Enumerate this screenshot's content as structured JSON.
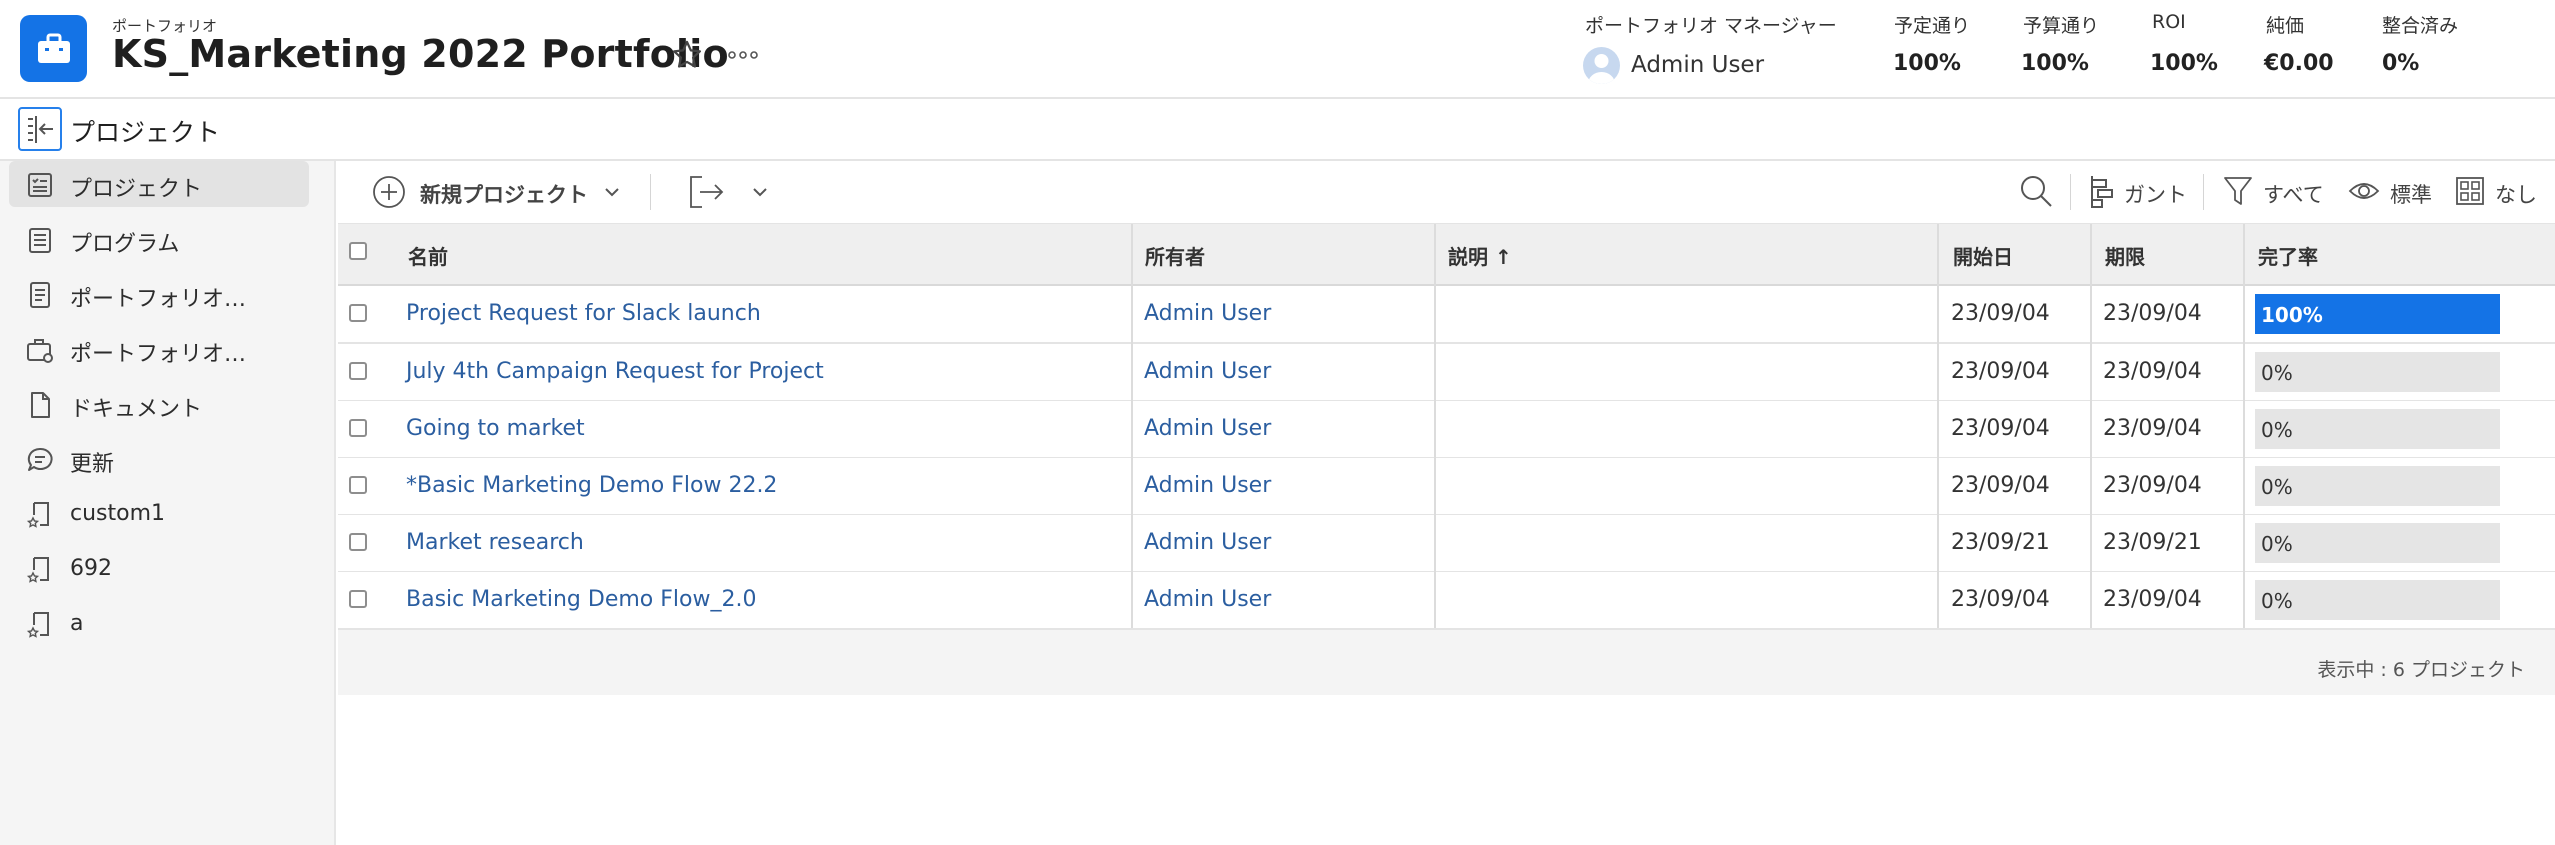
{
  "header": {
    "eyebrow": "ポートフォリオ",
    "title": "KS_Marketing 2022 Portfolio",
    "manager_label": "ポートフォリオ マネージャー",
    "manager_name": "Admin User",
    "metrics": [
      {
        "label": "予定通り",
        "value": "100%"
      },
      {
        "label": "予算通り",
        "value": "100%"
      },
      {
        "label": "ROI",
        "value": "100%"
      },
      {
        "label": "純価",
        "value": "€0.00"
      },
      {
        "label": "整合済み",
        "value": "0%"
      }
    ]
  },
  "subheader": {
    "title": "プロジェクト"
  },
  "sidebar": {
    "items": [
      {
        "label": "プロジェクト",
        "icon": "project-list-icon",
        "active": true
      },
      {
        "label": "プログラム",
        "icon": "program-list-icon"
      },
      {
        "label": "ポートフォリオ…",
        "icon": "portfolio-doc-icon"
      },
      {
        "label": "ポートフォリオ…",
        "icon": "portfolio-briefcase-icon"
      },
      {
        "label": "ドキュメント",
        "icon": "document-icon"
      },
      {
        "label": "更新",
        "icon": "comment-icon"
      },
      {
        "label": "custom1",
        "icon": "custom-tab-icon"
      },
      {
        "label": "692",
        "icon": "custom-tab-icon"
      },
      {
        "label": "a",
        "icon": "custom-tab-icon"
      }
    ]
  },
  "toolbar": {
    "new_project": "新規プロジェクト",
    "gantt": "ガント",
    "filter": "すべて",
    "view": "標準",
    "grouping": "なし"
  },
  "table": {
    "columns": {
      "name": "名前",
      "owner": "所有者",
      "description": "説明 ↑",
      "start": "開始日",
      "due": "期限",
      "complete": "完了率"
    },
    "rows": [
      {
        "name": "Project Request for Slack launch",
        "owner": "Admin User",
        "description": "",
        "start": "23/09/04",
        "due": "23/09/04",
        "complete_label": "100%",
        "complete": 100
      },
      {
        "name": "July 4th Campaign Request for Project",
        "owner": "Admin User",
        "description": "",
        "start": "23/09/04",
        "due": "23/09/04",
        "complete_label": "0%",
        "complete": 0
      },
      {
        "name": "Going to market",
        "owner": "Admin User",
        "description": "",
        "start": "23/09/04",
        "due": "23/09/04",
        "complete_label": "0%",
        "complete": 0
      },
      {
        "name": "*Basic Marketing Demo Flow 22.2",
        "owner": "Admin User",
        "description": "",
        "start": "23/09/04",
        "due": "23/09/04",
        "complete_label": "0%",
        "complete": 0
      },
      {
        "name": "Market research",
        "owner": "Admin User",
        "description": "",
        "start": "23/09/21",
        "due": "23/09/21",
        "complete_label": "0%",
        "complete": 0
      },
      {
        "name": "Basic Marketing Demo Flow_2.0",
        "owner": "Admin User",
        "description": "",
        "start": "23/09/04",
        "due": "23/09/04",
        "complete_label": "0%",
        "complete": 0
      }
    ],
    "footer": "表示中 : 6 プロジェクト"
  },
  "colors": {
    "accent": "#1473e6",
    "link": "#2b5ea0"
  }
}
